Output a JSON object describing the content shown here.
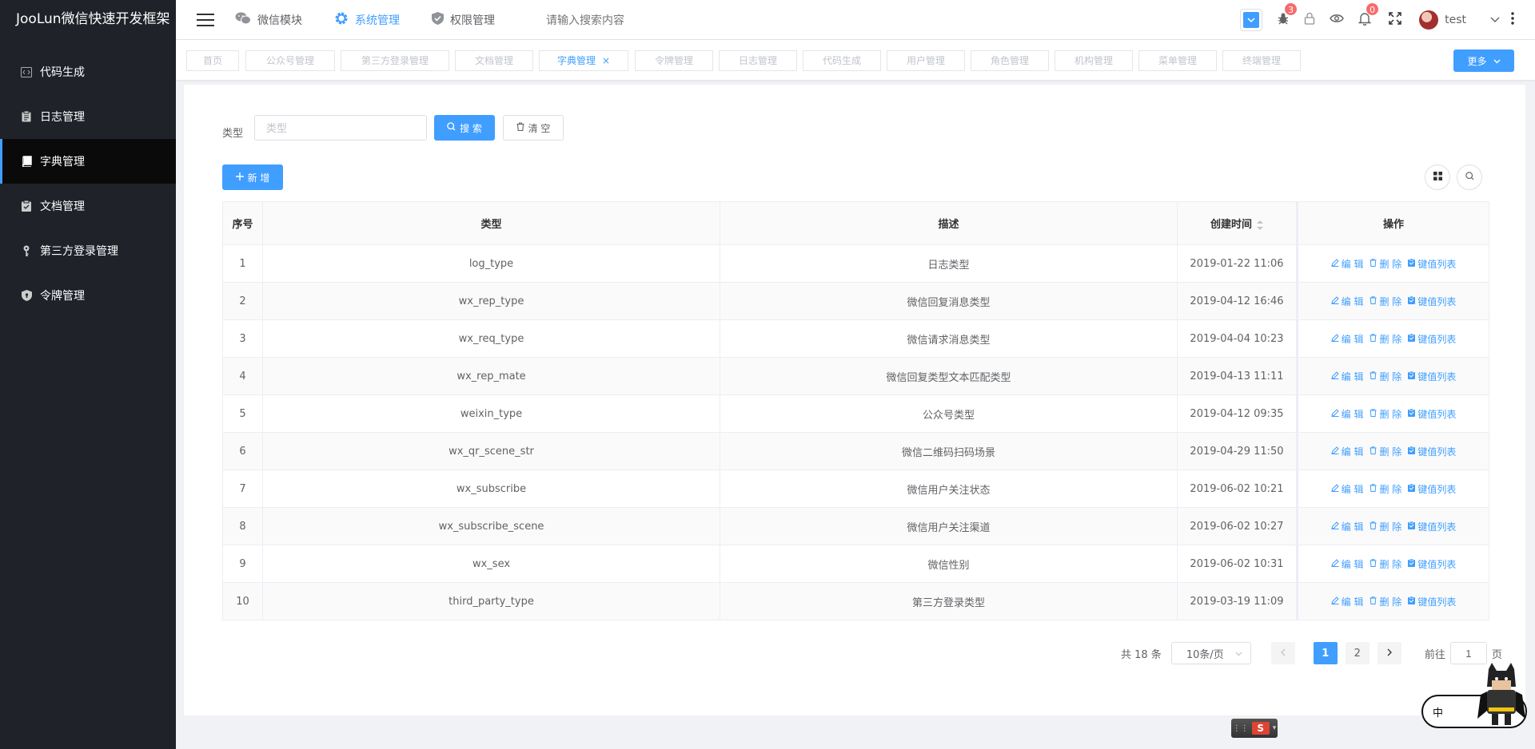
{
  "app": {
    "title": "JooLun微信快速开发框架"
  },
  "sidebar": {
    "items": [
      {
        "label": "代码生成",
        "icon": "code-icon"
      },
      {
        "label": "日志管理",
        "icon": "clipboard-icon"
      },
      {
        "label": "字典管理",
        "icon": "book-icon",
        "active": true
      },
      {
        "label": "文档管理",
        "icon": "document-check-icon"
      },
      {
        "label": "第三方登录管理",
        "icon": "key-icon"
      },
      {
        "label": "令牌管理",
        "icon": "shield-icon"
      }
    ]
  },
  "header": {
    "nav": [
      {
        "label": "微信模块",
        "icon": "wechat-icon"
      },
      {
        "label": "系统管理",
        "icon": "gear-icon",
        "active": true
      },
      {
        "label": "权限管理",
        "icon": "shield-check-icon"
      }
    ],
    "search_placeholder": "请输入搜索内容",
    "bug_badge": "3",
    "bell_badge": "0",
    "username": "test"
  },
  "tabs": {
    "items": [
      {
        "label": "首页"
      },
      {
        "label": "公众号管理"
      },
      {
        "label": "第三方登录管理"
      },
      {
        "label": "文档管理"
      },
      {
        "label": "字典管理",
        "active": true
      },
      {
        "label": "令牌管理"
      },
      {
        "label": "日志管理"
      },
      {
        "label": "代码生成"
      },
      {
        "label": "用户管理"
      },
      {
        "label": "角色管理"
      },
      {
        "label": "机构管理"
      },
      {
        "label": "菜单管理"
      },
      {
        "label": "终端管理"
      }
    ],
    "close_glyph": "×",
    "more_label": "更多"
  },
  "filter": {
    "label": "类型",
    "placeholder": "类型",
    "search_label": "搜 索",
    "clear_label": "清 空",
    "add_label": "新 增"
  },
  "table": {
    "headers": [
      "序号",
      "类型",
      "描述",
      "创建时间",
      "操作"
    ],
    "actions": {
      "edit": "编 辑",
      "delete": "删 除",
      "kv": "键值列表"
    },
    "rows": [
      [
        "1",
        "log_type",
        "日志类型",
        "2019-01-22 11:06"
      ],
      [
        "2",
        "wx_rep_type",
        "微信回复消息类型",
        "2019-04-12 16:46"
      ],
      [
        "3",
        "wx_req_type",
        "微信请求消息类型",
        "2019-04-04 10:23"
      ],
      [
        "4",
        "wx_rep_mate",
        "微信回复类型文本匹配类型",
        "2019-04-13 11:11"
      ],
      [
        "5",
        "weixin_type",
        "公众号类型",
        "2019-04-12 09:35"
      ],
      [
        "6",
        "wx_qr_scene_str",
        "微信二维码扫码场景",
        "2019-04-29 11:50"
      ],
      [
        "7",
        "wx_subscribe",
        "微信用户关注状态",
        "2019-06-02 10:21"
      ],
      [
        "8",
        "wx_subscribe_scene",
        "微信用户关注渠道",
        "2019-06-02 10:27"
      ],
      [
        "9",
        "wx_sex",
        "微信性别",
        "2019-06-02 10:31"
      ],
      [
        "10",
        "third_party_type",
        "第三方登录类型",
        "2019-03-19 11:09"
      ]
    ]
  },
  "pagination": {
    "total": "共 18 条",
    "page_size": "10条/页",
    "pages": [
      "1",
      "2"
    ],
    "current": "1",
    "goto_prefix": "前往",
    "goto_value": "1",
    "goto_suffix": "页"
  },
  "ime": {
    "logo": "S",
    "lang": "中"
  },
  "colors": {
    "accent": "#409eff",
    "sidebar_bg": "#20222a",
    "badge": "#f56c6c"
  }
}
